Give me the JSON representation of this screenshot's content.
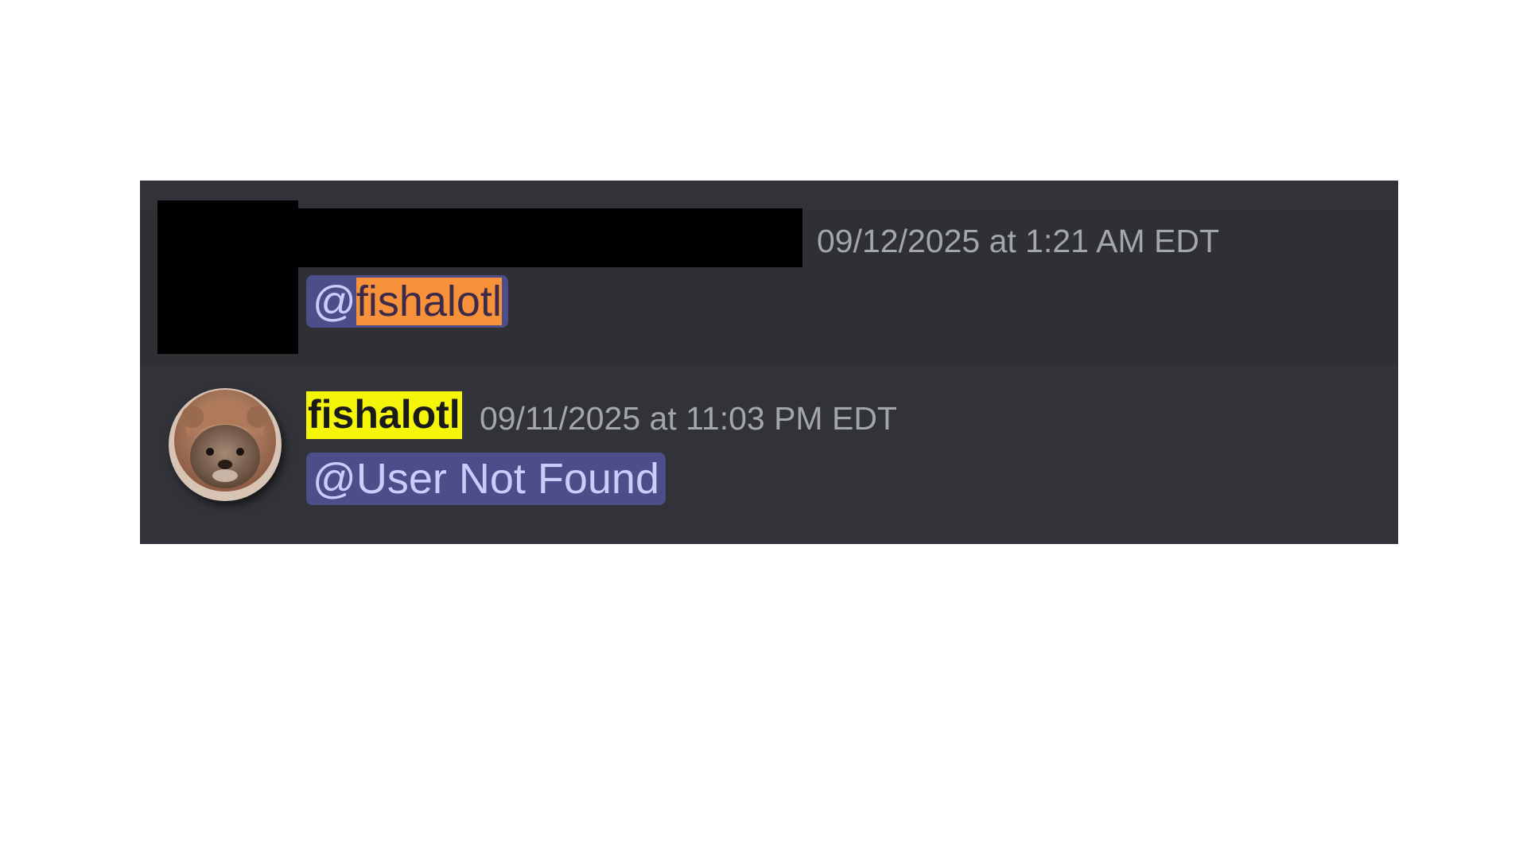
{
  "messages": [
    {
      "author": "",
      "timestamp": "09/12/2025 at 1:21 AM EDT",
      "mention_prefix": "@",
      "mention_highlighted": "fishalotl",
      "redacted": true
    },
    {
      "author": "fishalotl",
      "timestamp": "09/11/2025 at 11:03 PM EDT",
      "mention": "@User Not Found",
      "avatar_icon": "otter-avatar-icon"
    }
  ],
  "colors": {
    "background": "#313338",
    "mention_bg": "#4c4e8a",
    "mention_text": "#c9cdfb",
    "highlight_orange": "#f7923a",
    "highlight_yellow": "#f5f50a",
    "timestamp_text": "#a3a6ab"
  }
}
